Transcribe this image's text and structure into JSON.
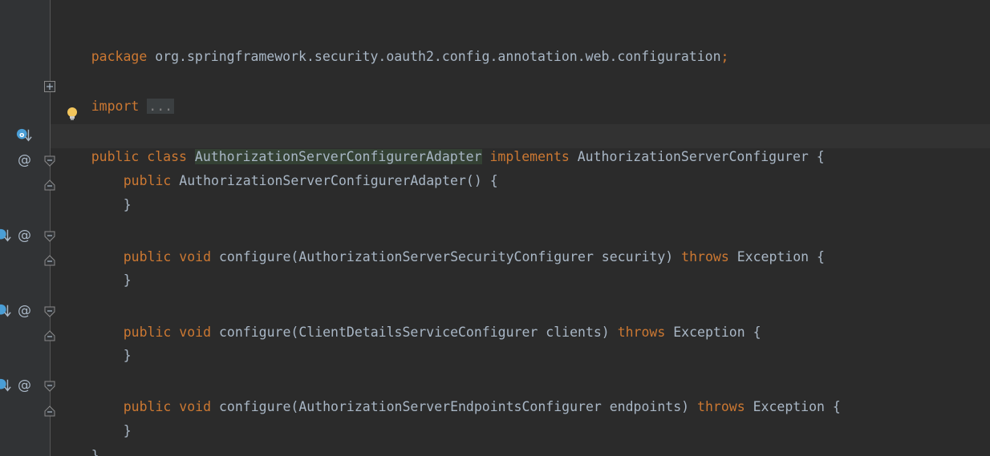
{
  "code": {
    "package_line": {
      "keyword": "package",
      "name": "org.springframework.security.oauth2.config.annotation.web.configuration",
      "semicolon": ";"
    },
    "import_line": {
      "keyword": "import",
      "folded": "..."
    },
    "class_line": {
      "kw_public": "public",
      "kw_class": "class",
      "class_name": "AuthorizationServerConfigurerAdapter",
      "kw_implements": "implements",
      "interface_name": "AuthorizationServerConfigurer",
      "brace": "{"
    },
    "constructor": {
      "kw_public": "public",
      "signature": "AuthorizationServerConfigurerAdapter() {",
      "close": "}"
    },
    "methods": [
      {
        "kw_public": "public",
        "kw_void": "void",
        "signature": "configure(AuthorizationServerSecurityConfigurer security)",
        "kw_throws": "throws",
        "exception": "Exception {",
        "close": "}"
      },
      {
        "kw_public": "public",
        "kw_void": "void",
        "signature": "configure(ClientDetailsServiceConfigurer clients)",
        "kw_throws": "throws",
        "exception": "Exception {",
        "close": "}"
      },
      {
        "kw_public": "public",
        "kw_void": "void",
        "signature": "configure(AuthorizationServerEndpointsConfigurer endpoints)",
        "kw_throws": "throws",
        "exception": "Exception {",
        "close": "}"
      }
    ],
    "class_close": "}"
  },
  "gutter": {
    "override_marker": "@"
  },
  "colors": {
    "background": "#2b2b2b",
    "gutter": "#313335",
    "keyword": "#cc7832",
    "text": "#a9b7c6",
    "caret_row": "#323232",
    "identifier_highlight": "#344134"
  },
  "icons": {
    "lightbulb": "intention-bulb-icon",
    "implemented": "implemented-method-icon",
    "override": "override-annotation-icon",
    "fold": "fold-toggle-icon"
  }
}
